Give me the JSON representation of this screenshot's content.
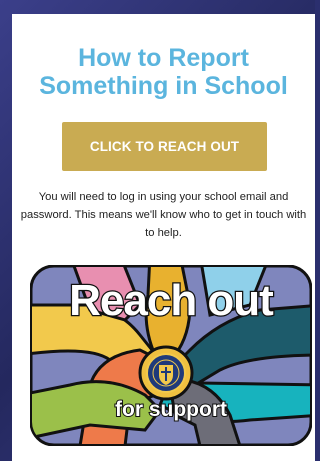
{
  "page": {
    "title": "How to Report Something in School",
    "cta_label": "CLICK TO REACH OUT",
    "description": "You will need to log in using your school email and password. This means we'll know who to get in touch with to help."
  },
  "banner": {
    "main_text": "Reach out",
    "sub_text": "for support",
    "emblem_icon": "school-crest-icon"
  },
  "colors": {
    "title": "#5bb5de",
    "button": "#c9ab52",
    "button_text": "#ffffff",
    "banner_bg": "#7f86bd"
  }
}
